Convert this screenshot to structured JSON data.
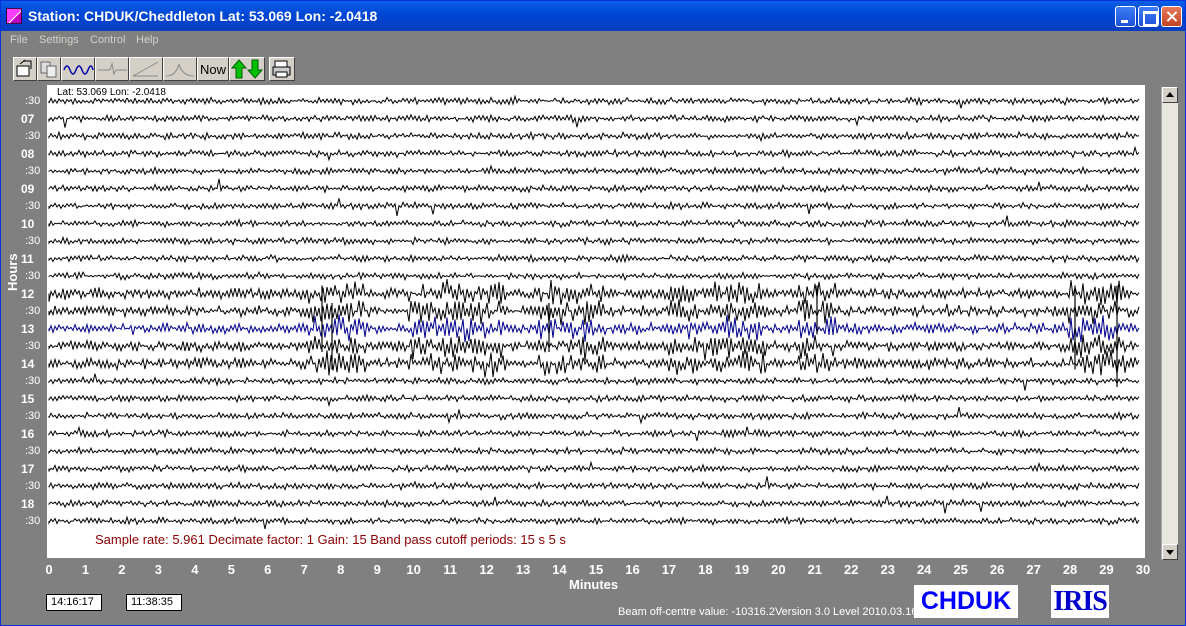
{
  "window": {
    "title": "Station: CHDUK/Cheddleton Lat: 53.069 Lon: -2.0418"
  },
  "menu": [
    "File",
    "Settings",
    "Control",
    "Help"
  ],
  "toolbar": {
    "icons": [
      "open-file-icon",
      "copy-icon",
      "waveform-icon",
      "flatline-icon",
      "ramp-icon",
      "pulse-icon",
      "now-button",
      "up-down-arrows-icon",
      "print-icon"
    ],
    "now_label": "Now"
  },
  "plot": {
    "latlon_label": "Lat: 53.069 Lon: -2.0418",
    "sample_info": "Sample rate: 5.961  Decimate factor: 1  Gain: 15  Band pass cutoff periods: 15 s 5 s",
    "y_axis_title": "Hours",
    "x_axis_title": "Minutes",
    "hour_labels": [
      "07",
      "08",
      "09",
      "10",
      "11",
      "12",
      "13",
      "14",
      "15",
      "16",
      "17",
      "18"
    ],
    "half_label": ":30",
    "minute_labels": [
      "0",
      "1",
      "2",
      "3",
      "4",
      "5",
      "6",
      "7",
      "8",
      "9",
      "10",
      "11",
      "12",
      "13",
      "14",
      "15",
      "16",
      "17",
      "18",
      "19",
      "20",
      "21",
      "22",
      "23",
      "24",
      "25",
      "26",
      "27",
      "28",
      "29",
      "30"
    ],
    "trace_color": "#000000",
    "event_color": "#00008b"
  },
  "status": {
    "time_1": "14:16:17",
    "time_2": "11:38:35",
    "beam_text": "Beam off-centre value: -10316.2Version 3.0 Level 2010.03.16",
    "station_logo": "CHDUK",
    "iris_logo": "IRIS"
  },
  "colors": {
    "background": "#808080",
    "plot_bg": "#ffffff",
    "sample_info": "#8b0000",
    "logo_text": "#0000ff"
  }
}
